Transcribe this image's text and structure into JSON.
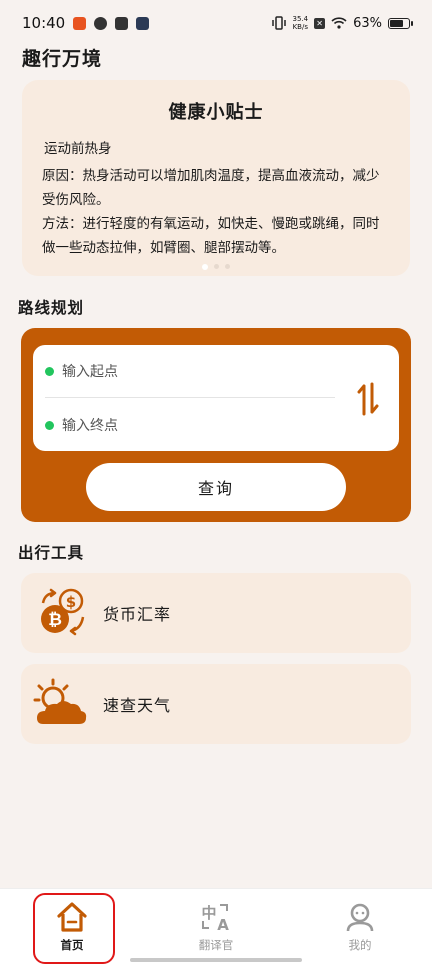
{
  "status_bar": {
    "time": "10:40",
    "speed_value": "35.4",
    "speed_unit": "KB/s",
    "battery_text": "63%",
    "battery_level": 0.63
  },
  "header": {
    "title": "趣行万境"
  },
  "tips": {
    "title": "健康小贴士",
    "subtitle": "运动前热身",
    "reason": "原因：热身活动可以增加肌肉温度，提高血液流动，减少受伤风险。",
    "method": "方法：进行轻度的有氧运动，如快走、慢跑或跳绳，同时做一些动态拉伸，如臂圈、腿部摆动等。",
    "page_count": 3,
    "active_page": 1
  },
  "route": {
    "section_title": "路线规划",
    "start_placeholder": "输入起点",
    "end_placeholder": "输入终点",
    "query_label": "查询",
    "accent_color": "#c25b05"
  },
  "tools": {
    "section_title": "出行工具",
    "items": [
      {
        "label": "货币汇率",
        "icon": "currency-exchange-icon"
      },
      {
        "label": "速查天气",
        "icon": "weather-icon"
      }
    ]
  },
  "bottom_nav": {
    "items": [
      {
        "label": "首页",
        "icon": "home-icon",
        "active": true
      },
      {
        "label": "翻译官",
        "icon": "translate-icon",
        "active": false
      },
      {
        "label": "我的",
        "icon": "profile-icon",
        "active": false
      }
    ]
  }
}
